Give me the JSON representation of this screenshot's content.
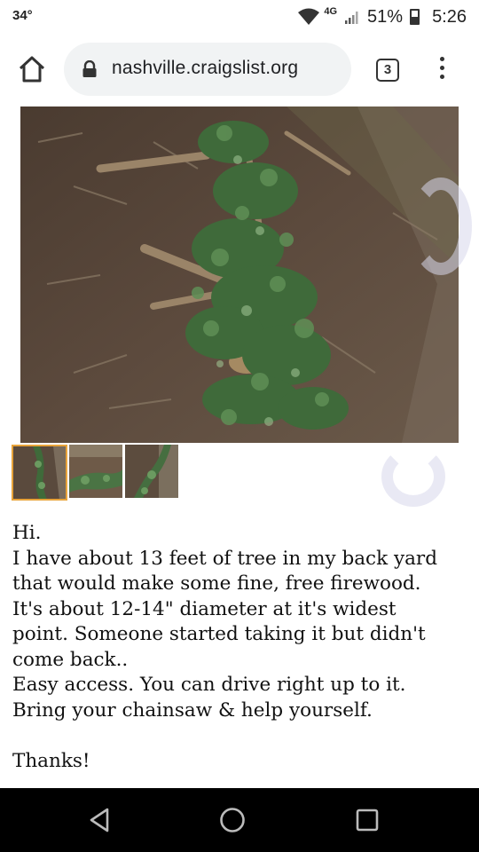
{
  "status_bar": {
    "temperature": "34°",
    "network": "4G",
    "battery": "51%",
    "time": "5:26"
  },
  "browser": {
    "url": "nashville.craigslist.org",
    "tab_count": "3"
  },
  "gallery": {
    "thumbnail_count": 3,
    "selected_index": 0
  },
  "description": {
    "lines": [
      "Hi.",
      "I have about 13 feet of tree in my back yard",
      "that would make some fine, free firewood.",
      "It's about 12-14\" diameter at it's widest",
      "point. Someone started taking it but didn't",
      "come back..",
      "Easy access. You can drive right up to it.",
      "Bring your chainsaw & help yourself.",
      "",
      "Thanks!"
    ]
  },
  "colors": {
    "selected_thumbnail_border": "#e8a33a",
    "nav_bar": "#000000",
    "url_bar": "#f1f3f4"
  }
}
